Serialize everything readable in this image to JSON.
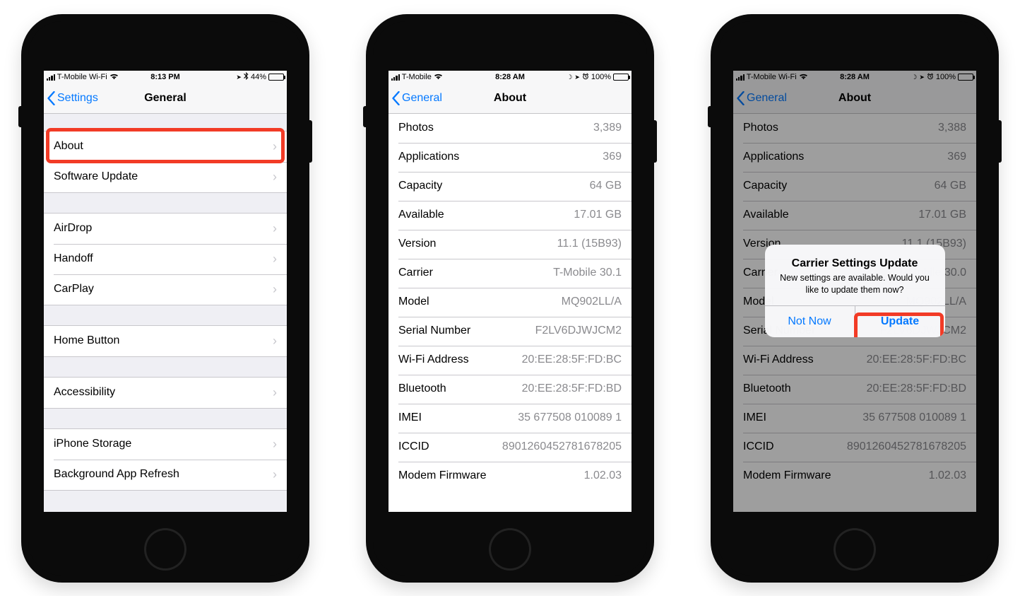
{
  "phone1": {
    "status": {
      "carrier": "T-Mobile Wi-Fi",
      "time": "8:13 PM",
      "battery_text": "44%",
      "bt_icon": "✱",
      "loc_icon": "➤"
    },
    "nav": {
      "back": "Settings",
      "title": "General"
    },
    "groups": [
      {
        "rows": [
          {
            "label": "About"
          },
          {
            "label": "Software Update"
          }
        ]
      },
      {
        "rows": [
          {
            "label": "AirDrop"
          },
          {
            "label": "Handoff"
          },
          {
            "label": "CarPlay"
          }
        ]
      },
      {
        "rows": [
          {
            "label": "Home Button"
          }
        ]
      },
      {
        "rows": [
          {
            "label": "Accessibility"
          }
        ]
      },
      {
        "rows": [
          {
            "label": "iPhone Storage"
          },
          {
            "label": "Background App Refresh"
          }
        ]
      }
    ]
  },
  "phone2": {
    "status": {
      "carrier": "T-Mobile",
      "time": "8:28 AM",
      "battery_text": "100%",
      "loc_icon": "➤",
      "alarm_icon": "⏰"
    },
    "nav": {
      "back": "General",
      "title": "About"
    },
    "rows": [
      {
        "label": "Photos",
        "value": "3,389"
      },
      {
        "label": "Applications",
        "value": "369"
      },
      {
        "label": "Capacity",
        "value": "64 GB"
      },
      {
        "label": "Available",
        "value": "17.01 GB"
      },
      {
        "label": "Version",
        "value": "11.1 (15B93)"
      },
      {
        "label": "Carrier",
        "value": "T-Mobile 30.1"
      },
      {
        "label": "Model",
        "value": "MQ902LL/A"
      },
      {
        "label": "Serial Number",
        "value": "F2LV6DJWJCM2"
      },
      {
        "label": "Wi-Fi Address",
        "value": "20:EE:28:5F:FD:BC"
      },
      {
        "label": "Bluetooth",
        "value": "20:EE:28:5F:FD:BD"
      },
      {
        "label": "IMEI",
        "value": "35 677508 010089 1"
      },
      {
        "label": "ICCID",
        "value": "8901260452781678205"
      },
      {
        "label": "Modem Firmware",
        "value": "1.02.03"
      }
    ]
  },
  "phone3": {
    "status": {
      "carrier": "T-Mobile Wi-Fi",
      "time": "8:28 AM",
      "battery_text": "100%",
      "loc_icon": "➤",
      "alarm_icon": "⏰"
    },
    "nav": {
      "back": "General",
      "title": "About"
    },
    "rows": [
      {
        "label": "Photos",
        "value": "3,388"
      },
      {
        "label": "Applications",
        "value": "369"
      },
      {
        "label": "Capacity",
        "value": "64 GB"
      },
      {
        "label": "Available",
        "value": "17.01 GB"
      },
      {
        "label": "Version",
        "value": "11.1 (15B93)"
      },
      {
        "label": "Carrier",
        "value": "T-Mobile 30.0"
      },
      {
        "label": "Model",
        "value": "MQ902LL/A"
      },
      {
        "label": "Serial Number",
        "value": "F2LV6DJWJCM2"
      },
      {
        "label": "Wi-Fi Address",
        "value": "20:EE:28:5F:FD:BC"
      },
      {
        "label": "Bluetooth",
        "value": "20:EE:28:5F:FD:BD"
      },
      {
        "label": "IMEI",
        "value": "35 677508 010089 1"
      },
      {
        "label": "ICCID",
        "value": "8901260452781678205"
      },
      {
        "label": "Modem Firmware",
        "value": "1.02.03"
      }
    ],
    "alert": {
      "title": "Carrier Settings Update",
      "message": "New settings are available. Would you like to update them now?",
      "not_now": "Not Now",
      "update": "Update"
    }
  }
}
